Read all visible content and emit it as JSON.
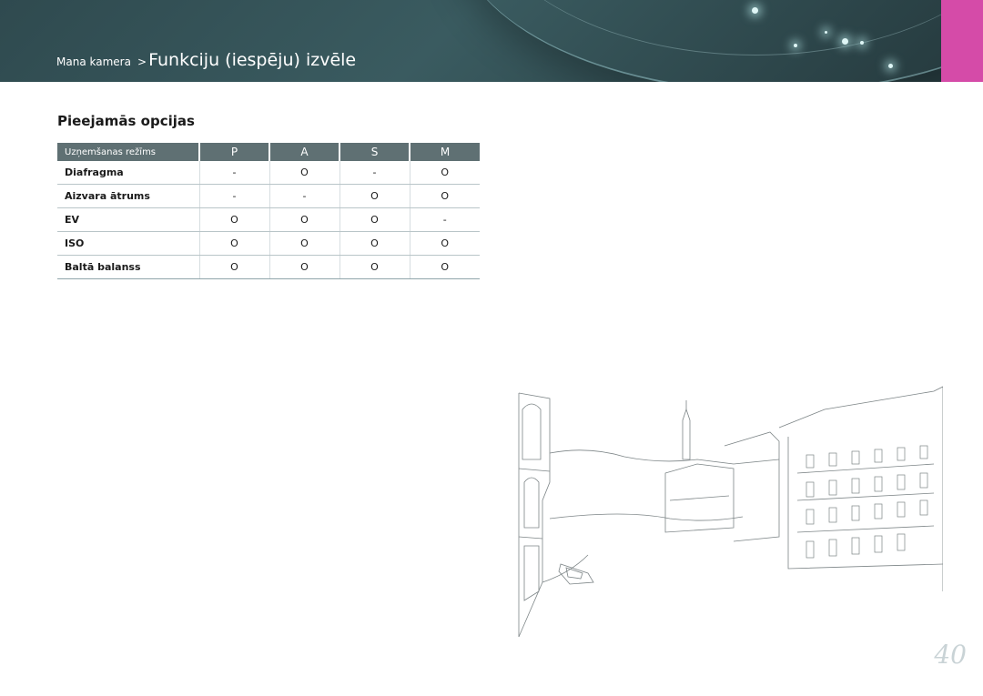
{
  "header": {
    "breadcrumb_parent": "Mana kamera",
    "breadcrumb_separator": ">",
    "breadcrumb_current": "Funkciju (iespēju) izvēle",
    "accent_color": "#d54ba8",
    "background_color": "#2f4a4f"
  },
  "section": {
    "title": "Pieejamās opcijas"
  },
  "table": {
    "headers": [
      "Uzņemšanas režīms",
      "P",
      "A",
      "S",
      "M"
    ],
    "rows": [
      {
        "label": "Diafragma",
        "values": [
          "-",
          "O",
          "-",
          "O"
        ]
      },
      {
        "label": "Aizvara ātrums",
        "values": [
          "-",
          "-",
          "O",
          "O"
        ]
      },
      {
        "label": "EV",
        "values": [
          "O",
          "O",
          "O",
          "-"
        ]
      },
      {
        "label": "ISO",
        "values": [
          "O",
          "O",
          "O",
          "O"
        ]
      },
      {
        "label": "Baltā balanss",
        "values": [
          "O",
          "O",
          "O",
          "O"
        ]
      }
    ]
  },
  "illustration": {
    "icon": "city-canal-sketch"
  },
  "page_number": "40"
}
